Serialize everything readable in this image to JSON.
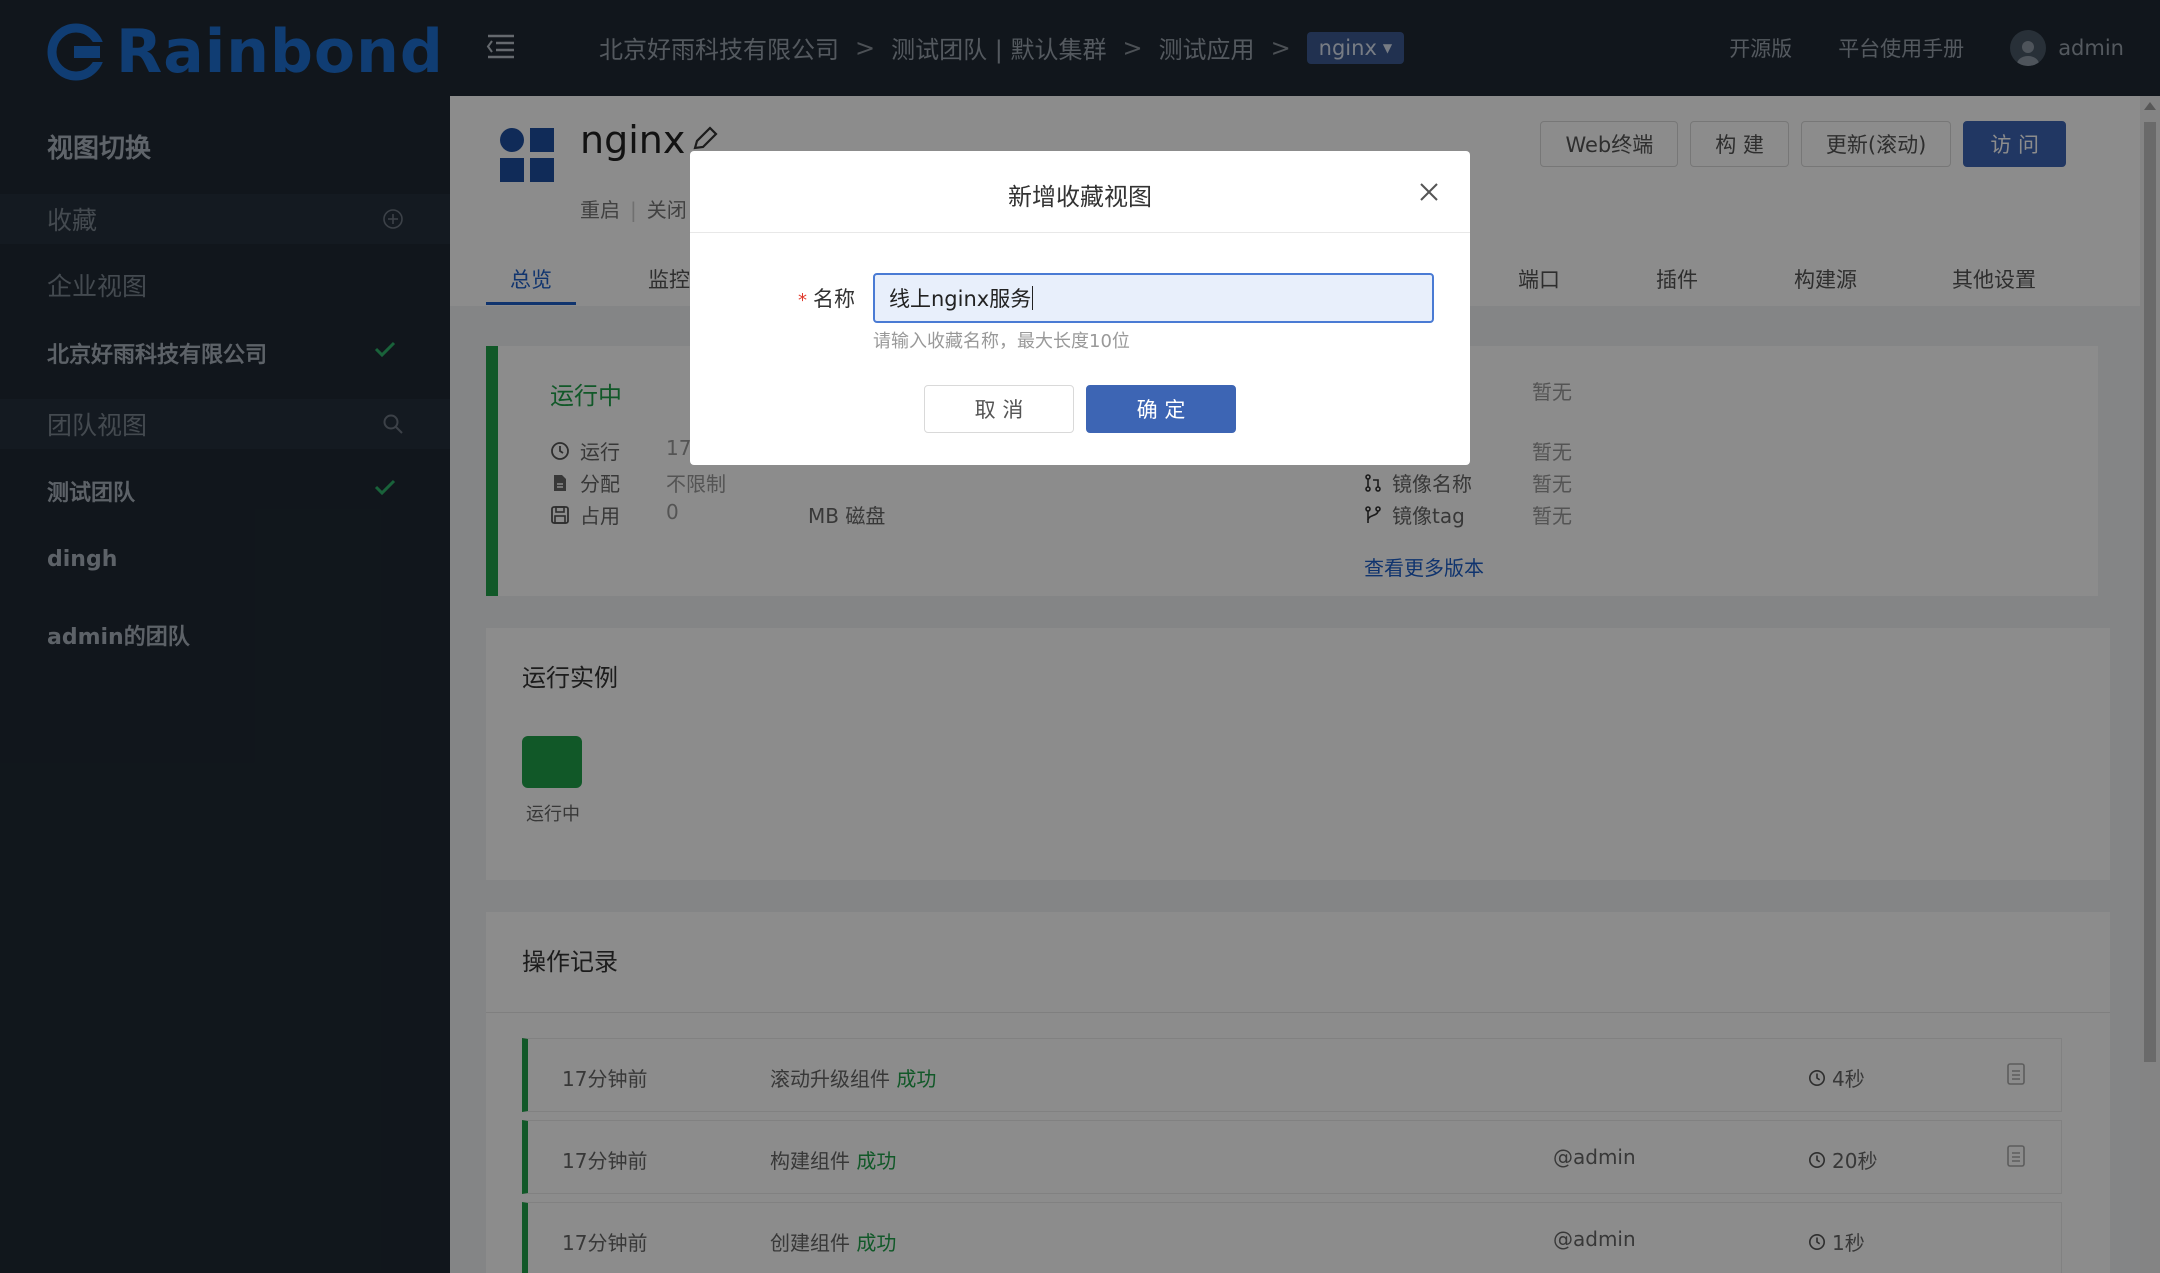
{
  "brand": {
    "name": "Rainbond",
    "color": "#1e6fd1"
  },
  "sidebar": {
    "heading": "视图切换",
    "favorites_label": "收藏",
    "enterprise_view_label": "企业视图",
    "enterprise_name": "北京好雨科技有限公司",
    "team_view_label": "团队视图",
    "teams": [
      "测试团队",
      "dingh",
      "admin的团队"
    ]
  },
  "topbar": {
    "breadcrumb": [
      "北京好雨科技有限公司",
      "测试团队 | 默认集群",
      "测试应用"
    ],
    "current_component": "nginx",
    "separator": ">",
    "open_source_label": "开源版",
    "manual_label": "平台使用手册",
    "username": "admin"
  },
  "app": {
    "name": "nginx",
    "actions": [
      "重启",
      "关闭"
    ],
    "buttons": [
      "Web终端",
      "构 建",
      "更新(滚动)",
      "访 问"
    ],
    "tabs": [
      "总览",
      "监控",
      "端口",
      "插件",
      "构建源",
      "其他设置"
    ]
  },
  "status": {
    "state": "运行中",
    "rows": [
      {
        "label": "运行",
        "value": "17"
      },
      {
        "label": "分配",
        "value": "不限制"
      },
      {
        "label": "占用",
        "value": "0",
        "unit": "MB 磁盘"
      }
    ],
    "version_rows": [
      {
        "label": "",
        "value": "暂无"
      },
      {
        "label": "",
        "value": "暂无"
      },
      {
        "label": "镜像名称",
        "value": "暂无"
      },
      {
        "label": "镜像tag",
        "value": "暂无"
      }
    ],
    "more_versions": "查看更多版本",
    "color_running": "#1fa14a"
  },
  "instances": {
    "title": "运行实例",
    "items": [
      {
        "state": "运行中"
      }
    ]
  },
  "operations": {
    "title": "操作记录",
    "rows": [
      {
        "time": "17分钟前",
        "action": "滚动升级组件",
        "result": "成功",
        "user": "",
        "duration": "4秒"
      },
      {
        "time": "17分钟前",
        "action": "构建组件",
        "result": "成功",
        "user": "@admin",
        "duration": "20秒"
      },
      {
        "time": "17分钟前",
        "action": "创建组件",
        "result": "成功",
        "user": "@admin",
        "duration": "1秒"
      }
    ]
  },
  "modal": {
    "title": "新增收藏视图",
    "field_label": "名称",
    "required_mark": "*",
    "input_value": "线上nginx服务",
    "hint": "请输入收藏名称，最大长度10位",
    "cancel_label": "取 消",
    "ok_label": "确 定",
    "accent": "#3d65b4"
  }
}
